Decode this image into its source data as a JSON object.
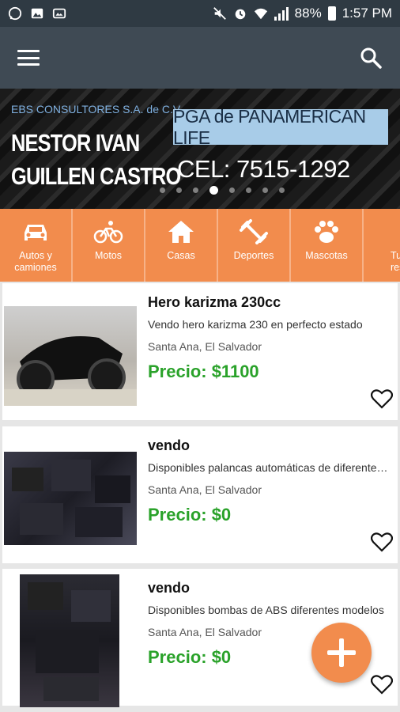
{
  "status_bar": {
    "battery": "88%",
    "time": "1:57 PM"
  },
  "banner": {
    "company": "EBS CONSULTORES S.A. de C.V",
    "name_line1": "NESTOR IVAN",
    "name_line2": "GUILLEN CASTRO",
    "pga": "PGA de PANAMERICAN LIFE",
    "cel": "CEL: 7515-1292",
    "dots_count": 8,
    "active_dot": 3
  },
  "categories": [
    {
      "label": "Autos y camiones",
      "icon": "car-icon"
    },
    {
      "label": "Motos",
      "icon": "bicycle-icon"
    },
    {
      "label": "Casas",
      "icon": "house-icon"
    },
    {
      "label": "Deportes",
      "icon": "dumbbell-icon"
    },
    {
      "label": "Mascotas",
      "icon": "paw-icon"
    },
    {
      "label": "Turis restau",
      "icon": "fork-icon"
    }
  ],
  "listings": [
    {
      "title": "Hero karizma 230cc",
      "description": "Vendo hero karizma 230 en perfecto estado",
      "location": "Santa Ana, El Salvador",
      "price": "Precio: $1100"
    },
    {
      "title": "vendo",
      "description": "Disponibles palancas automáticas de diferentes modelos",
      "location": "Santa Ana, El Salvador",
      "price": "Precio: $0"
    },
    {
      "title": "vendo",
      "description": "Disponibles bombas de ABS diferentes modelos",
      "location": "Santa Ana, El Salvador",
      "price": "Precio: $0"
    }
  ],
  "colors": {
    "accent": "#f28c4d",
    "app_bar": "#3f4a54",
    "status_bar": "#2f3a43",
    "price": "#2aa22a"
  }
}
